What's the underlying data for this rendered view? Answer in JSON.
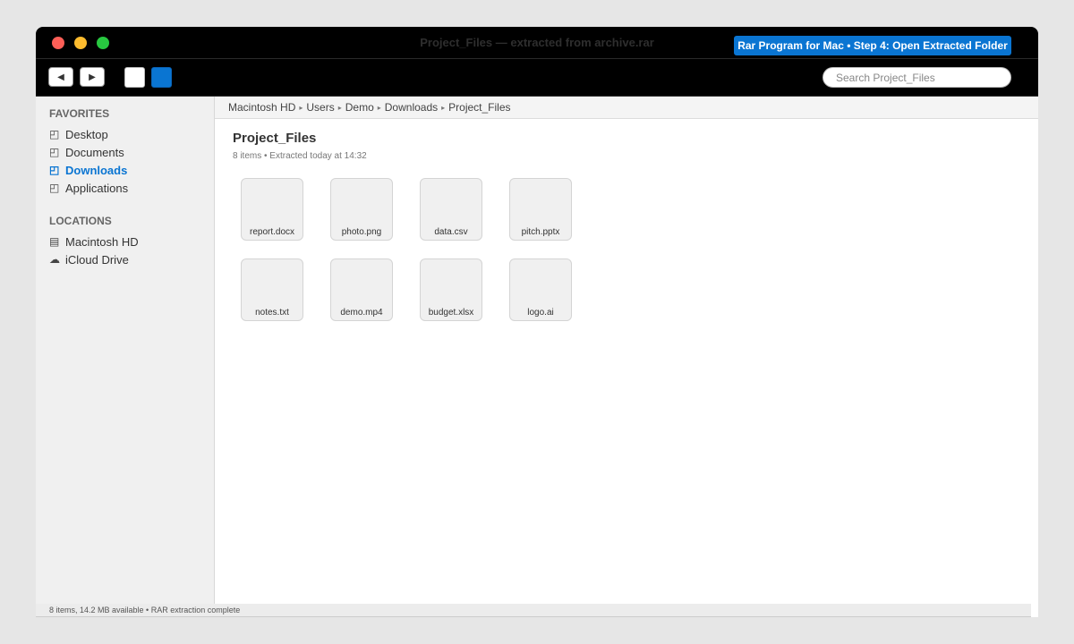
{
  "window": {
    "title": "Project_Files — extracted from archive.rar",
    "step_banner": "Rar Program for Mac • Step 4: Open Extracted Folder"
  },
  "toolbar": {
    "back_label": "◀",
    "forward_label": "▶",
    "search_placeholder": "Search Project_Files"
  },
  "sidebar": {
    "favorites_header": "FAVORITES",
    "favorites": [
      {
        "label": "Desktop",
        "icon": "folder-icon",
        "glyph": "⌂"
      },
      {
        "label": "Documents",
        "icon": "folder-icon",
        "glyph": "⌂"
      },
      {
        "label": "Downloads",
        "icon": "folder-icon",
        "glyph": "⌂"
      },
      {
        "label": "Applications",
        "icon": "folder-icon",
        "glyph": "⌂"
      }
    ],
    "active_favorite": "Downloads",
    "locations_header": "LOCATIONS",
    "locations": [
      {
        "label": "Macintosh HD",
        "icon": "drive-icon",
        "glyph": "🖴"
      },
      {
        "label": "iCloud Drive",
        "icon": "cloud-icon",
        "glyph": "☁"
      }
    ]
  },
  "breadcrumb": [
    "Macintosh HD",
    "Users",
    "Demo",
    "Downloads",
    "Project_Files"
  ],
  "folder": {
    "title": "Project_Files",
    "subtitle": "8 items • Extracted today at 14:32"
  },
  "files": [
    "report.docx",
    "photo.png",
    "data.csv",
    "pitch.pptx",
    "notes.txt",
    "demo.mp4",
    "budget.xlsx",
    "logo.ai"
  ],
  "statusbar": {
    "text": "8 items, 14.2 MB available • RAR extraction complete"
  },
  "colors": {
    "accent": "#0a75d2",
    "close": "#fe5f57",
    "minimize": "#febc2e",
    "zoom": "#28c840"
  }
}
